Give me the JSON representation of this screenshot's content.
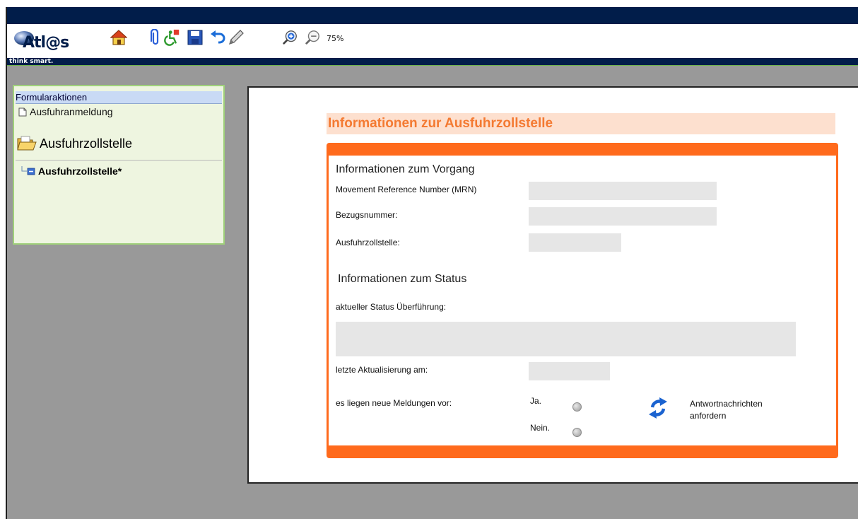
{
  "app": {
    "logo_text": "Atl@s",
    "tagline": "think smart.",
    "zoom": "75%"
  },
  "toolbar": {
    "icons": [
      "home-icon",
      "attachment-icon",
      "accessibility-icon",
      "save-icon",
      "undo-icon",
      "pen-icon",
      "zoom-in-icon",
      "zoom-out-icon"
    ]
  },
  "sidebar": {
    "header": "Formularaktionen",
    "document_item": "Ausfuhranmeldung",
    "folder_title": "Ausfuhrzollstelle",
    "tree_node": "Ausfuhrzollstelle*"
  },
  "form": {
    "title": "Informationen zur Ausfuhrzollstelle",
    "section_vorgang": "Informationen zum Vorgang",
    "mrn_label": "Movement Reference Number (MRN)",
    "bezugsnummer_label": "Bezugsnummer:",
    "ausfuhrzollstelle_label": "Ausfuhrzollstelle:",
    "section_status": "Informationen zum Status",
    "status_label": "aktueller Status Überführung:",
    "aktualisierung_label": "letzte Aktualisierung am:",
    "meldungen_label": "es liegen neue Meldungen vor:",
    "ja_label": "Ja.",
    "nein_label": "Nein.",
    "antwort_line1": "Antwortnachrichten",
    "antwort_line2": "anfordern"
  },
  "colors": {
    "navy": "#011d4a",
    "orange": "#ff6a1c",
    "title_orange": "#f47a32",
    "title_band": "#fde0cf"
  }
}
